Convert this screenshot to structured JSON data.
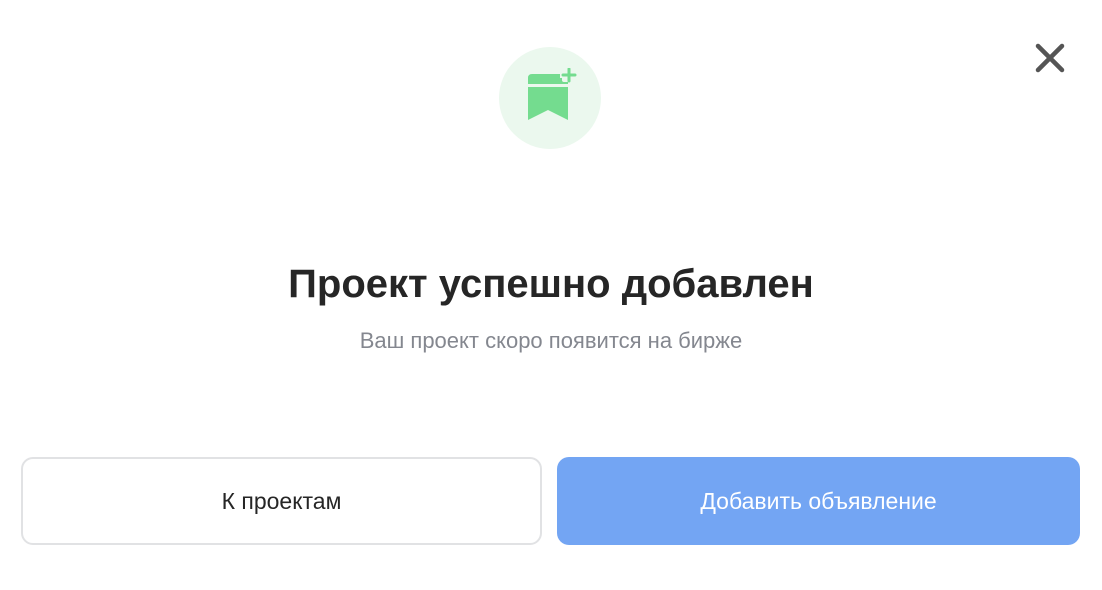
{
  "dialog": {
    "title": "Проект успешно добавлен",
    "subtitle": "Ваш проект скоро появится на бирже",
    "icon": "bookmark-plus-icon",
    "close_icon": "close-icon"
  },
  "actions": {
    "secondary_label": "К проектам",
    "primary_label": "Добавить объявление"
  },
  "colors": {
    "accent_green": "#74dc8f",
    "icon_bg": "#ebf8ee",
    "primary_button": "#73a5f3",
    "title_text": "#262626",
    "subtitle_text": "#84878f"
  }
}
